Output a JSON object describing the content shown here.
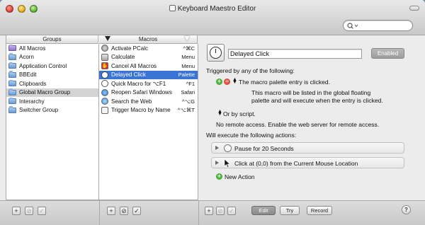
{
  "window": {
    "title": "Keyboard Maestro Editor",
    "search_placeholder": ""
  },
  "groups": {
    "header": "Groups",
    "items": [
      {
        "label": "All Macros",
        "icon": "smart-folder-icon",
        "selected": false
      },
      {
        "label": "Acorn",
        "icon": "folder-icon",
        "selected": false
      },
      {
        "label": "Application Control",
        "icon": "folder-icon",
        "selected": false
      },
      {
        "label": "BBEdit",
        "icon": "folder-icon",
        "selected": false
      },
      {
        "label": "Clipboards",
        "icon": "folder-icon",
        "selected": false
      },
      {
        "label": "Global Macro Group",
        "icon": "folder-icon",
        "selected": true
      },
      {
        "label": "Interarchy",
        "icon": "folder-icon",
        "selected": false
      },
      {
        "label": "Switcher Group",
        "icon": "folder-icon",
        "selected": false
      }
    ]
  },
  "macros": {
    "header": "Macros",
    "items": [
      {
        "label": "Activate PCalc",
        "shortcut": "^⌘C",
        "icon": "gear-icon"
      },
      {
        "label": "Calculate",
        "shortcut": "Menu",
        "icon": "calculator-icon"
      },
      {
        "label": "Cancel All Macros",
        "shortcut": "Menu",
        "icon": "stop-icon"
      },
      {
        "label": "Delayed Click",
        "shortcut": "Palette",
        "icon": "clock-icon",
        "selected": true
      },
      {
        "label": "Quick Macro for ⌥F1",
        "shortcut": "^F1",
        "icon": "magnifier-icon"
      },
      {
        "label": "Reopen Safari Windows",
        "shortcut": "Safari",
        "icon": "safari-icon"
      },
      {
        "label": "Search the Web",
        "shortcut": "^⌥G",
        "icon": "globe-icon"
      },
      {
        "label": "Trigger Macro by Name",
        "shortcut": "^⌥⌘T",
        "icon": "keyboard-maestro-icon"
      }
    ]
  },
  "editor": {
    "macro_name": "Delayed Click",
    "enabled_label": "Enabled",
    "triggered_label": "Triggered by any of the following:",
    "trigger_text": "The macro palette entry is clicked.",
    "trigger_desc_line1": "This macro will be listed in the global floating",
    "trigger_desc_line2": "palette and will execute when the entry is clicked.",
    "or_by_script": "Or by script.",
    "remote_text": "No remote access.  Enable the web server for remote access.",
    "will_execute_label": "Will execute the following actions:",
    "actions": [
      {
        "label": "Pause for 20 Seconds",
        "icon": "clock-icon"
      },
      {
        "label": "Click at (0,0) from the Current Mouse Location",
        "icon": "mouse-cursor-icon"
      }
    ],
    "new_action_label": "New Action"
  },
  "toolbar": {
    "add": "+",
    "edit_label": "Edit",
    "try_label": "Try",
    "record_label": "Record",
    "help_label": "?"
  }
}
